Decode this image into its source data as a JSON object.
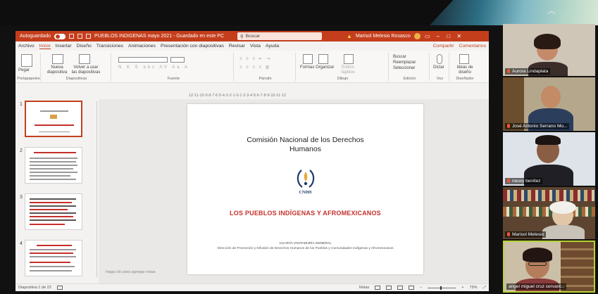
{
  "window": {
    "autosave_label": "Autoguardado",
    "file_title": "PUEBLOS INDIGENAS mayo 2021 - Guardado en este PC",
    "search_label": "Buscar",
    "user_name": "Marisol Melesio Rosasco"
  },
  "menu": {
    "tabs": [
      "Archivo",
      "Inicio",
      "Insertar",
      "Diseño",
      "Transiciones",
      "Animaciones",
      "Presentación con diapositivas",
      "Revisar",
      "Vista",
      "Ayuda"
    ],
    "active_tab": "Inicio",
    "share_label": "Compartir",
    "comments_label": "Comentarios"
  },
  "ribbon": {
    "paste": "Pegar",
    "new_slide": "Nueva diapositiva",
    "reuse_slides": "Volver a usar las diapositivas",
    "clipboard_group": "Portapapeles",
    "slides_group": "Diapositivas",
    "font_group": "Fuente",
    "paragraph_group": "Párrafo",
    "shapes_arrange": "Formas Organizar",
    "quick_styles": "Estilos rápidos",
    "drawing_group": "Dibujo",
    "find": "Buscar",
    "replace": "Reemplazar",
    "select": "Seleccionar",
    "editing_group": "Edición",
    "dictate": "Dictar",
    "voice_group": "Voz",
    "designer": "Ideas de diseño",
    "designer_group": "Diseñador"
  },
  "ruler_text": "12·11·10·9·8·7·6·5·4·3·2·1·0·1·2·3·4·5·6·7·8·9·10·11·12",
  "thumbnails": [
    {
      "number": "1"
    },
    {
      "number": "2"
    },
    {
      "number": "3"
    },
    {
      "number": "4"
    }
  ],
  "slide": {
    "org_line1": "Comisión Nacional de los Derechos",
    "org_line2": "Humanos",
    "logo_text": "CNDH",
    "title": "LOS PUEBLOS INDÍGENAS Y AFROMEXICANOS",
    "subtitle": "CUARTA VISITADURÍA GENERAL",
    "directorate": "Dirección de Promoción y Difusión de Derechos Humanos de los Pueblos y Comunidades Indígenas y Afromexicanos"
  },
  "notes_placeholder": "Haga clic para agregar notas",
  "status": {
    "slide_counter": "Diapositiva 1 de 22",
    "notes_button": "Notas",
    "zoom": "75%"
  },
  "participants": [
    {
      "name": "Aurora Lindaplata"
    },
    {
      "name": "José Antonio Serrano Mo..."
    },
    {
      "name": "neuvy benítez"
    },
    {
      "name": "Marisol Melesio"
    },
    {
      "name": "angel miguel cruz cervant..."
    }
  ],
  "colors": {
    "ppt_accent": "#c43e1c",
    "slide_title_red": "#c4302b",
    "active_speaker": "#b7d334"
  }
}
